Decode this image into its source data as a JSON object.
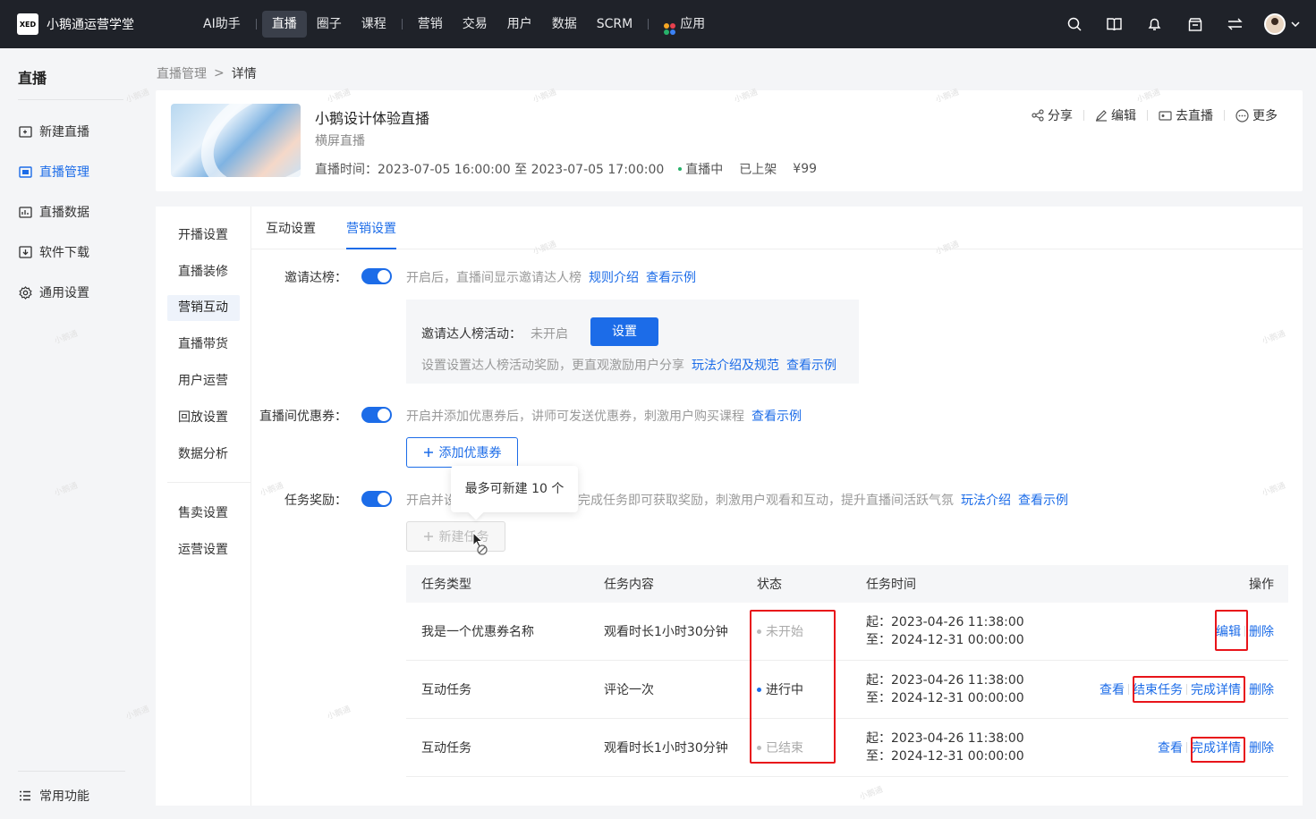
{
  "topbar": {
    "logo": "XED",
    "brand": "小鹅通运营学堂",
    "nav": [
      "AI助手",
      "直播",
      "圈子",
      "课程",
      "营销",
      "交易",
      "用户",
      "数据",
      "SCRM",
      "应用"
    ]
  },
  "sidebar": {
    "title": "直播",
    "items": [
      "新建直播",
      "直播管理",
      "直播数据",
      "软件下载",
      "通用设置"
    ],
    "bottom": "常用功能"
  },
  "breadcrumb": {
    "parent": "直播管理",
    "sep": ">",
    "current": "详情"
  },
  "course": {
    "title": "小鹅设计体验直播",
    "type": "横屏直播",
    "time": "直播时间：2023-07-05 16:00:00 至 2023-07-05 17:00:00",
    "status": "直播中",
    "shelf": "已上架",
    "price": "¥99",
    "actions": [
      "分享",
      "编辑",
      "去直播",
      "更多"
    ]
  },
  "subnav": {
    "group1": [
      "开播设置",
      "直播装修",
      "营销互动",
      "直播带货",
      "用户运营",
      "回放设置",
      "数据分析"
    ],
    "group2": [
      "售卖设置",
      "运营设置"
    ]
  },
  "tabs": [
    "互动设置",
    "营销设置"
  ],
  "invite": {
    "label": "邀请达榜：",
    "hint": "开启后，直播间显示邀请达人榜",
    "link1": "规则介绍",
    "link2": "查看示例",
    "box_label": "邀请达人榜活动：",
    "box_status": "未开启",
    "box_button": "设置",
    "box_hint": "设置设置达人榜活动奖励，更直观激励用户分享",
    "box_link1": "玩法介绍及规范",
    "box_link2": "查看示例"
  },
  "coupon": {
    "label": "直播间优惠券：",
    "hint": "开启并添加优惠券后，讲师可发送优惠券，刺激用户购买课程",
    "link": "查看示例",
    "button": "添加优惠券"
  },
  "task": {
    "label": "任务奖励：",
    "hint_a": "开启并设",
    "hint_b": "完成任务即可获取奖励，刺激用户观看和互动，提升直播间活跃气氛",
    "link1": "玩法介绍",
    "link2": "查看示例",
    "button": "新建任务",
    "tooltip": "最多可新建 10 个"
  },
  "table": {
    "headers": [
      "任务类型",
      "任务内容",
      "状态",
      "任务时间",
      "操作"
    ],
    "rows": [
      {
        "type": "我是一个优惠券名称",
        "content": "观看时长1小时30分钟",
        "status": "未开始",
        "start": "起：2023-04-26 11:38:00",
        "end": "至：2024-12-31 00:00:00",
        "ops": [
          "编辑",
          "删除"
        ]
      },
      {
        "type": "互动任务",
        "content": "评论一次",
        "status": "进行中",
        "start": "起：2023-04-26 11:38:00",
        "end": "至：2024-12-31 00:00:00",
        "ops": [
          "查看",
          "结束任务",
          "完成详情",
          "删除"
        ]
      },
      {
        "type": "互动任务",
        "content": "观看时长1小时30分钟",
        "status": "已结束",
        "start": "起：2023-04-26 11:38:00",
        "end": "至：2024-12-31 00:00:00",
        "ops": [
          "查看",
          "完成详情",
          "删除"
        ]
      }
    ]
  },
  "watermark": "小鹅通",
  "colors": {
    "primary": "#1c6ce8",
    "topbar": "#1f2229",
    "highlight": "#e8141a",
    "live": "#27b26a"
  }
}
